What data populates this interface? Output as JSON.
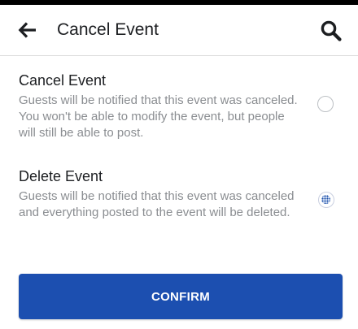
{
  "header": {
    "title": "Cancel Event",
    "back_icon": "back-arrow-icon",
    "search_icon": "search-icon"
  },
  "options": [
    {
      "title": "Cancel Event",
      "description": "Guests will be notified that this event was canceled. You won't be able to modify the event, but people will still be able to post.",
      "selected": false
    },
    {
      "title": "Delete Event",
      "description": "Guests will be notified that this event was canceled and everything posted to the event will be deleted.",
      "selected": true
    }
  ],
  "confirm_label": "CONFIRM",
  "colors": {
    "primary": "#1c4fb0",
    "text": "#1c1e21",
    "secondary_text": "#8a8d91"
  }
}
